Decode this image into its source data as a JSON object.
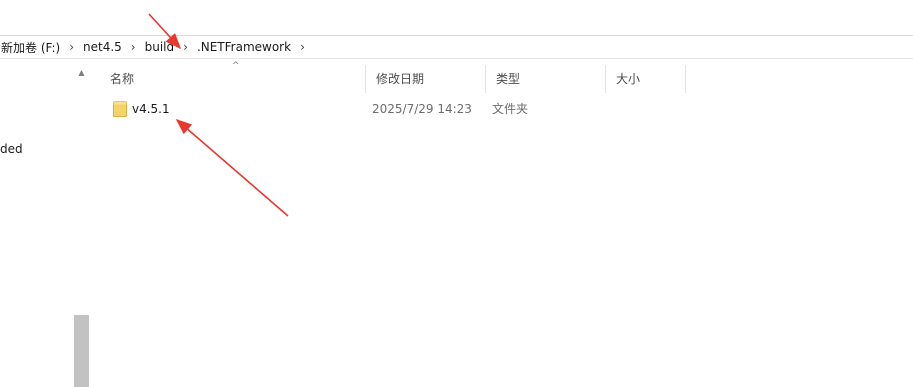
{
  "address_bar": {
    "crumbs": [
      "新加卷 (F:)",
      "net4.5",
      "build",
      ".NETFramework"
    ]
  },
  "nav_pane": {
    "partial_item": "ded"
  },
  "columns": {
    "name": "名称",
    "date_modified": "修改日期",
    "type": "类型",
    "size": "大小"
  },
  "files": [
    {
      "name": "v4.5.1",
      "date_modified": "2025/7/29 14:23",
      "type": "文件夹",
      "size": ""
    }
  ],
  "colors": {
    "annotation_arrow": "#e8372c",
    "folder": "#f6d26a"
  }
}
